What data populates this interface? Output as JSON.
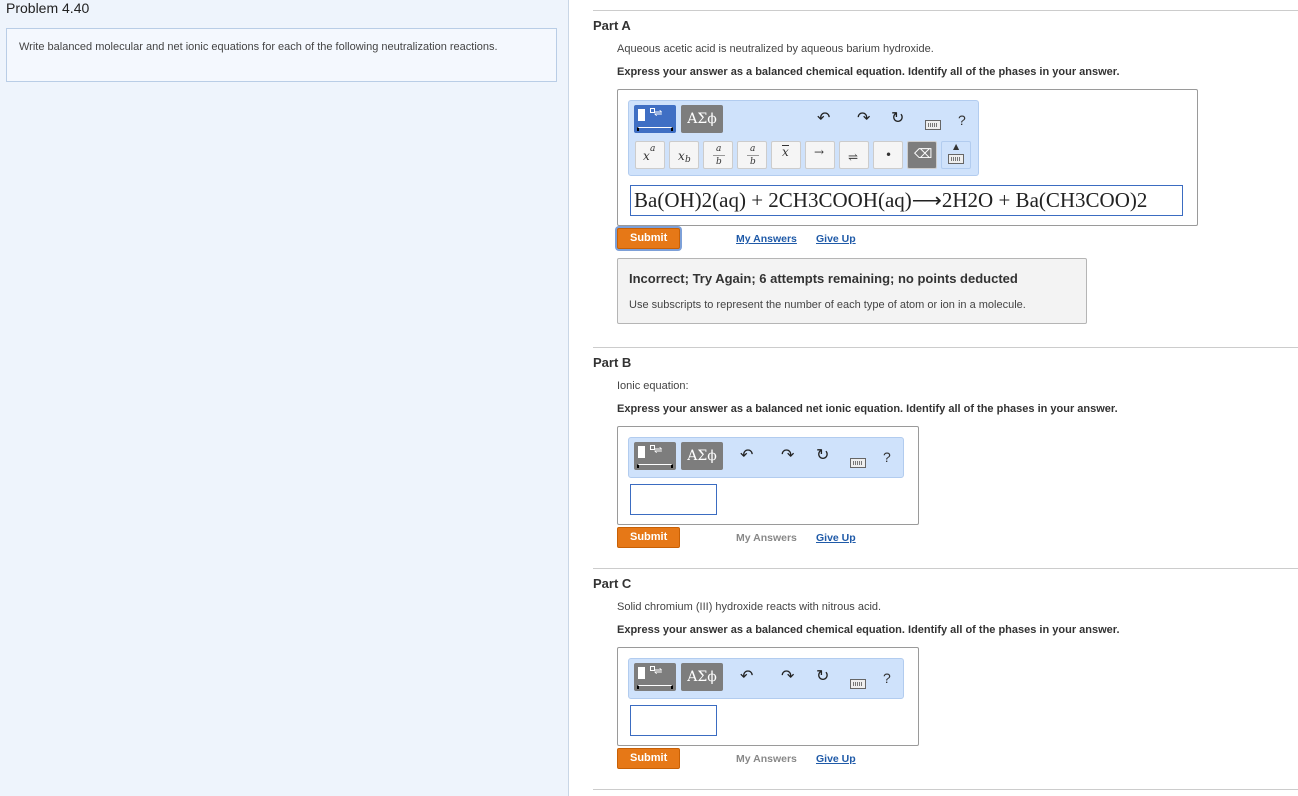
{
  "problem": {
    "title": "Problem 4.40",
    "instructions": "Write balanced molecular and net ionic equations for each of the following neutralization reactions."
  },
  "toolbar": {
    "greek_label": "ΑΣϕ",
    "help_label": "?",
    "symbols": {
      "superscript": "x",
      "superscript_sup": "a",
      "subscript": "x",
      "subscript_sub": "b",
      "fraction_num": "a",
      "fraction_den": "b",
      "overbar": "x",
      "arrow": "→",
      "equilibrium": "⇌",
      "dot": "•",
      "backspace": "⌫"
    }
  },
  "parts": {
    "a": {
      "title": "Part A",
      "prompt": "Aqueous acetic acid is neutralized by aqueous barium hydroxide.",
      "instruction": "Express your answer as a balanced chemical equation. Identify all of the phases in your answer.",
      "answer": "Ba(OH)2(aq) + 2CH3COOH(aq)⟶2H2O + Ba(CH3COO)2",
      "submit_label": "Submit",
      "my_answers_label": "My Answers",
      "give_up_label": "Give Up",
      "feedback": {
        "title": "Incorrect; Try Again; 6 attempts remaining; no points deducted",
        "text": "Use subscripts to represent the number of each type of atom or ion in a molecule."
      }
    },
    "b": {
      "title": "Part B",
      "prompt": "Ionic equation:",
      "instruction": "Express your answer as a balanced net ionic equation. Identify all of the phases in your answer.",
      "answer": "",
      "submit_label": "Submit",
      "my_answers_label": "My Answers",
      "give_up_label": "Give Up"
    },
    "c": {
      "title": "Part C",
      "prompt": "Solid chromium (III) hydroxide reacts with nitrous acid.",
      "instruction": "Express your answer as a balanced chemical equation. Identify all of the phases in your answer.",
      "answer": "",
      "submit_label": "Submit",
      "my_answers_label": "My Answers",
      "give_up_label": "Give Up"
    }
  },
  "colors": {
    "submit": "#e67817",
    "link": "#1f5aa8",
    "toolbar_bg": "#cfe2fb",
    "left_pane_bg": "#eef4fc"
  }
}
